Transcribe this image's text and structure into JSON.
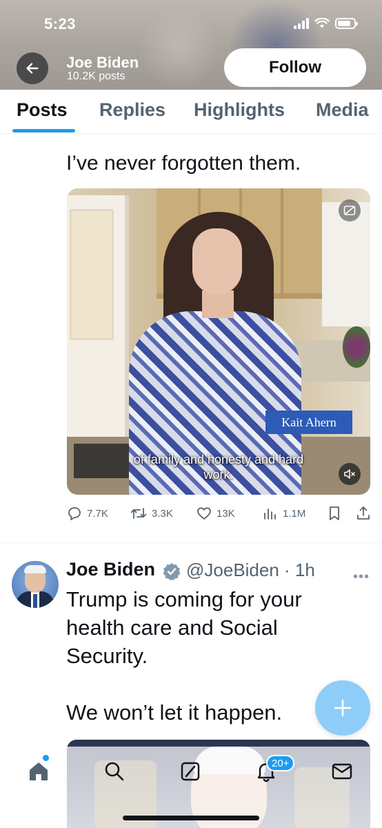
{
  "status_bar": {
    "time": "5:23"
  },
  "header": {
    "profile_name": "Joe Biden",
    "post_count": "10.2K posts",
    "follow_label": "Follow"
  },
  "tabs": [
    {
      "label": "Posts",
      "active": true
    },
    {
      "label": "Replies",
      "active": false
    },
    {
      "label": "Highlights",
      "active": false
    },
    {
      "label": "Media",
      "active": false
    }
  ],
  "tweet1": {
    "text": "I’ve never forgotten them.",
    "video": {
      "name_badge": "Kait Ahern",
      "caption": "of family and honesty and hard work."
    },
    "actions": {
      "replies": "7.7K",
      "reposts": "3.3K",
      "likes": "13K",
      "views": "1.1M"
    }
  },
  "tweet2": {
    "author_name": "Joe Biden",
    "author_handle": "@JoeBiden · 1h",
    "text": "Trump is coming for your health care and Social Security.\n\nWe won’t let it happen."
  },
  "bottom_nav": {
    "items": [
      "home-icon",
      "search-icon",
      "grok-icon",
      "notifications-icon",
      "messages-icon"
    ],
    "notification_badge": "20+"
  },
  "colors": {
    "accent": "#1d9bf0",
    "fab": "#8ecdf8",
    "text_primary": "#0f1419",
    "text_secondary": "#536471"
  }
}
